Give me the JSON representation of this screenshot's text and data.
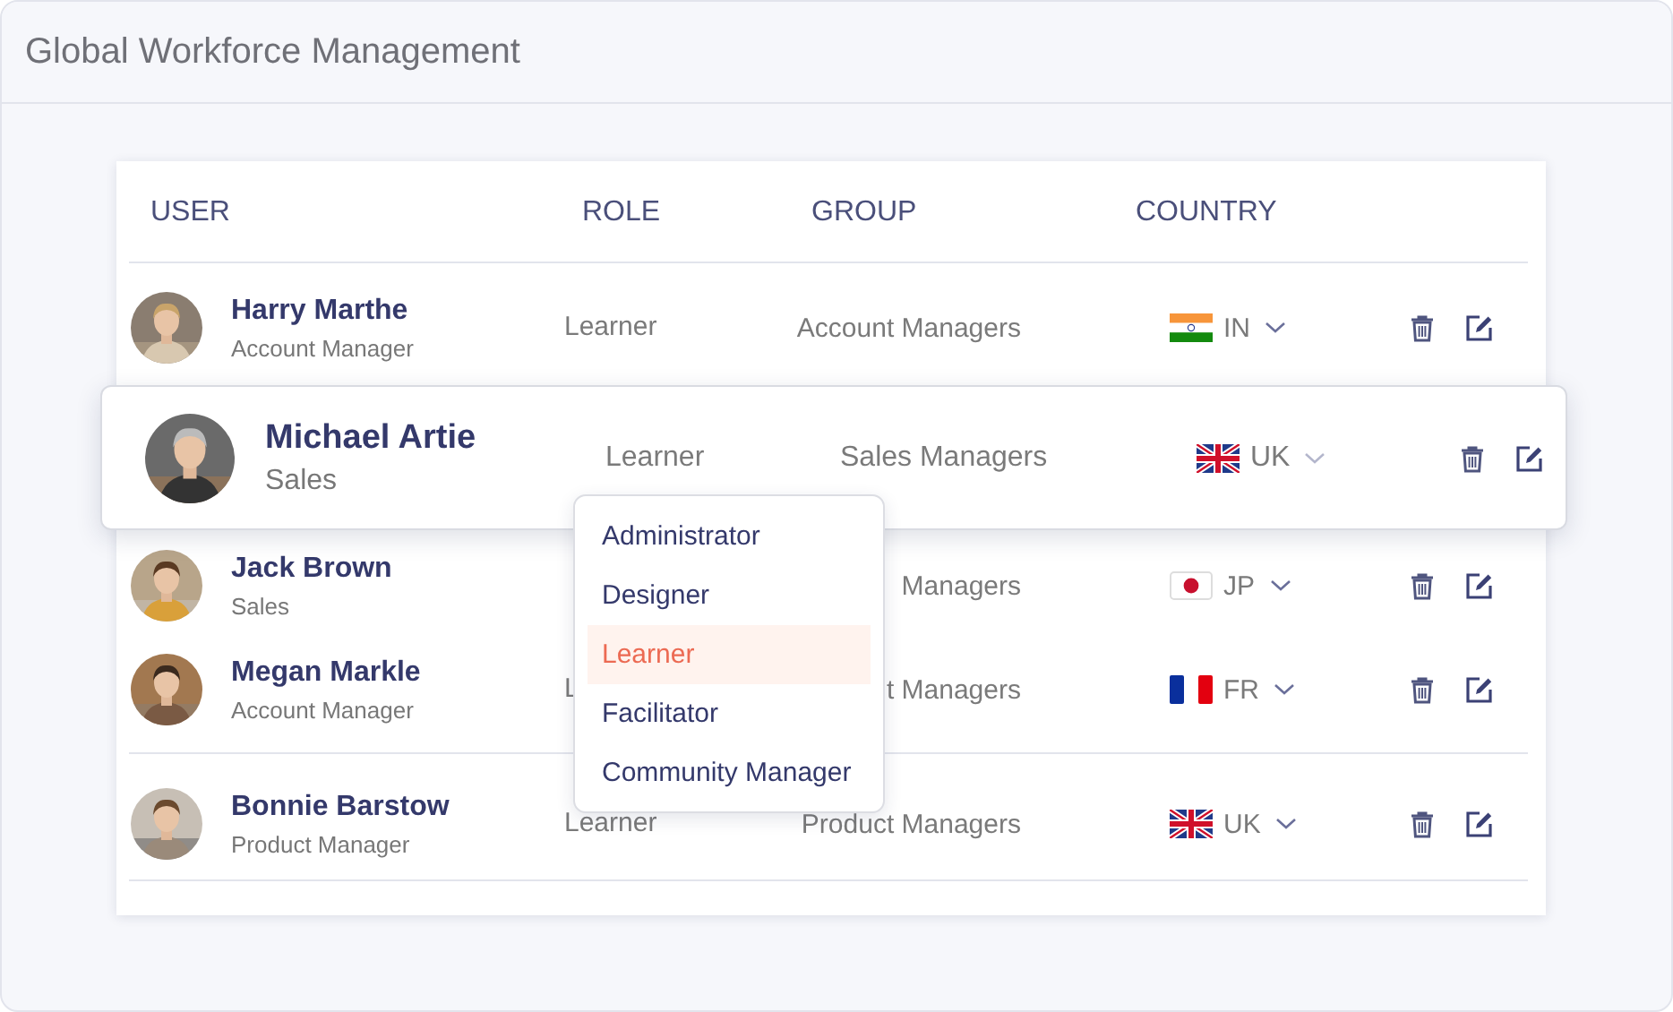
{
  "window": {
    "title": "Global Workforce Management"
  },
  "table": {
    "columns": [
      "USER",
      "ROLE",
      "GROUP",
      "COUNTRY"
    ],
    "rows": [
      {
        "name": "Harry Marthe",
        "title": "Account Manager",
        "role": "Learner",
        "group": "Account Managers",
        "country": "IN",
        "kind": "india",
        "selected": false
      },
      {
        "name": "Michael Artie",
        "title": "Sales",
        "role": "Learner",
        "group": "Sales Managers",
        "country": "UK",
        "kind": "britain",
        "selected": true
      },
      {
        "name": "Jack Brown",
        "title": "Sales",
        "group": "Managers",
        "country": "JP",
        "kind": "japan",
        "selected": false
      },
      {
        "name": "Megan Markle",
        "title": "Account Manager",
        "role": "L",
        "group": "t Managers",
        "country": "FR",
        "kind": "france",
        "selected": false
      },
      {
        "name": "Bonnie Barstow",
        "title": "Product Manager",
        "role": "Learner",
        "group": "Product Managers",
        "country": "UK",
        "kind": "britain",
        "selected": false
      }
    ]
  },
  "role_menu": {
    "items": [
      {
        "label": "Administrator",
        "selected": false
      },
      {
        "label": "Designer",
        "selected": false
      },
      {
        "label": "Learner",
        "selected": true
      },
      {
        "label": "Facilitator",
        "selected": false
      },
      {
        "label": "Community Manager",
        "selected": false
      }
    ]
  }
}
